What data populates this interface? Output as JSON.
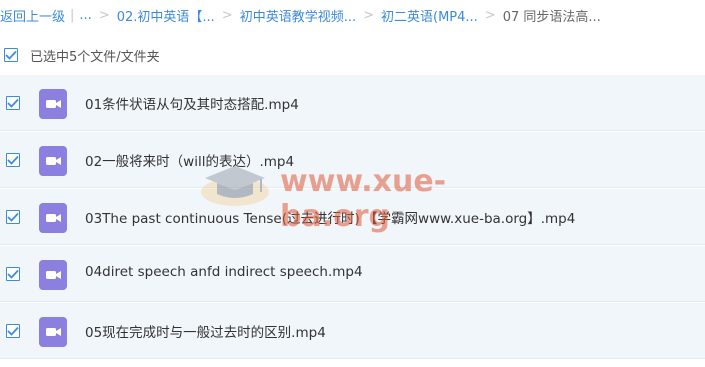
{
  "breadcrumb": {
    "back": "返回上一级",
    "ellipsis": "...",
    "items": [
      "02.初中英语【...",
      "初中英语教学视频...",
      "初二英语(MP4..."
    ],
    "current": "07 同步语法高..."
  },
  "selection": {
    "label": "已选中5个文件/文件夹",
    "checked": true
  },
  "files": [
    {
      "name": "01条件状语从句及其时态搭配.mp4",
      "checked": true,
      "icon": "video-file-icon"
    },
    {
      "name": "02一般将来时（will的表达）.mp4",
      "checked": true,
      "icon": "video-file-icon"
    },
    {
      "name": "03The past continuous Tense(过去进行时) 【学霸网www.xue-ba.org】.mp4",
      "checked": true,
      "icon": "video-file-icon"
    },
    {
      "name": "04diret speech anfd indirect speech.mp4",
      "checked": true,
      "icon": "video-file-icon"
    },
    {
      "name": "05现在完成时与一般过去时的区别.mp4",
      "checked": true,
      "icon": "video-file-icon"
    }
  ],
  "watermark": {
    "text": "www.xue-ba.org"
  },
  "colors": {
    "link": "#3b8bd9",
    "checkbox": "#3b8cdf",
    "row_bg": "#f1f6fb",
    "video_icon": "#8b7fe0",
    "watermark": "#e05a3a"
  }
}
